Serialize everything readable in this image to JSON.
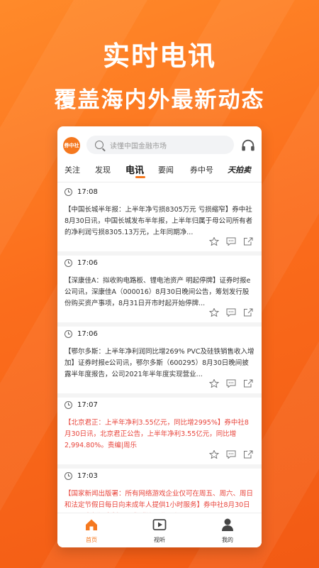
{
  "hero": {
    "title": "实时电讯",
    "subtitle": "覆盖海内外最新动态"
  },
  "app": {
    "logo_text": "券中社",
    "search": {
      "placeholder": "读懂中国金融市场"
    },
    "tabs": [
      {
        "label": "关注",
        "active": false
      },
      {
        "label": "发现",
        "active": false
      },
      {
        "label": "电讯",
        "active": true
      },
      {
        "label": "要闻",
        "active": false
      },
      {
        "label": "券中号",
        "active": false
      },
      {
        "label": "天拍卖",
        "active": false
      }
    ],
    "feed": [
      {
        "time": "17:08",
        "text": "【中国长城半年报：上半年净亏损8305万元 亏损缩窄】券中社8月30日讯，中国长城发布半年报，上半年归属于母公司所有者的净利润亏损8305.13万元，上年同期净...",
        "highlight": false
      },
      {
        "time": "17:06",
        "text": "【深康佳A：拟收购电路板、锂电池资产 明起停牌】证券时报e公司讯，深康佳A（000016）8月30日晚间公告，筹划发行股份购买资产事项，8月31日开市时起开始停牌...",
        "highlight": false
      },
      {
        "time": "17:06",
        "text": "【鄂尔多斯：上半年净利润同比增269% PVC及硅铁销售收入增加】证券时报e公司讯，鄂尔多斯（600295）8月30日晚间披露半年度报告，公司2021年半年度实现营业...",
        "highlight": false
      },
      {
        "time": "17:07",
        "text": "【北京君正：上半年净利3.55亿元，同比增2995%】券中社8月30日讯，北京君正公告，上半年净利3.55亿元，同比增2,994.80%。责编|周乐",
        "highlight": true
      },
      {
        "time": "17:03",
        "text": "【国家新闻出版署：所有网络游戏企业仅可在周五、周六、周日和法定节假日每日向未成年人提供1小时服务】券中社8月30日讯，国家新闻出版署下发《关于进一步...",
        "highlight": true
      }
    ],
    "bottom_nav": [
      {
        "label": "首页",
        "icon": "home-icon",
        "active": true
      },
      {
        "label": "视听",
        "icon": "video-icon",
        "active": false
      },
      {
        "label": "我的",
        "icon": "user-icon",
        "active": false
      }
    ]
  },
  "colors": {
    "accent": "#f5781f",
    "headline_red": "#e8453c",
    "background": "#fb6d1c"
  }
}
